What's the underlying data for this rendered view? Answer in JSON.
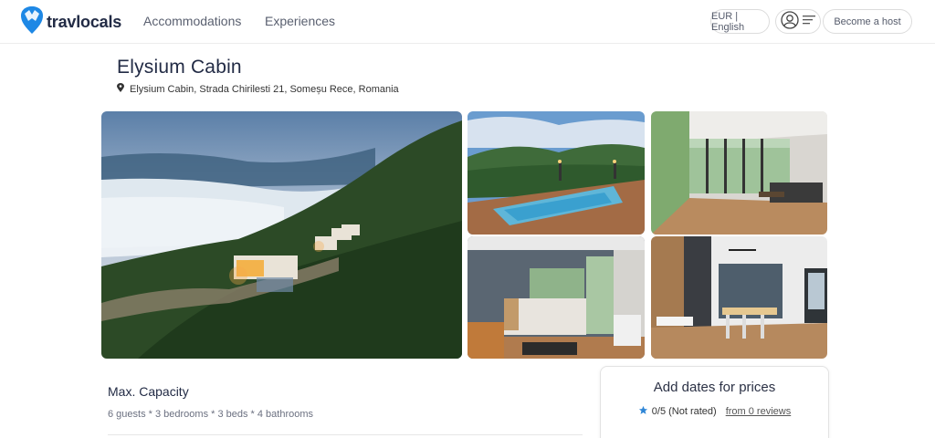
{
  "header": {
    "logo_text": "travlocals",
    "nav": {
      "accommodations": "Accommodations",
      "experiences": "Experiences"
    },
    "currency_language": "EUR | English",
    "become_host": "Become a host"
  },
  "listing": {
    "title": "Elysium Cabin",
    "address": "Elysium Cabin, Strada Chirilesti 21, Someșu Rece, Romania"
  },
  "capacity": {
    "title": "Max. Capacity",
    "details": "6 guests * 3 bedrooms * 3 beds * 4 bathrooms"
  },
  "booking": {
    "title": "Add dates for prices",
    "rating": "0/5 (Not rated)",
    "reviews": "from 0 reviews"
  },
  "colors": {
    "brand": "#1e88e5",
    "star": "#2f86d6",
    "text_dark": "#222b45"
  }
}
